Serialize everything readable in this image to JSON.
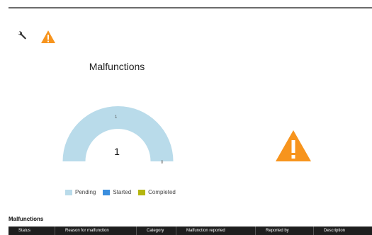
{
  "icons": {
    "tool": "wrench-icon",
    "alert": "warning-icon",
    "alert_color": "#f7941d"
  },
  "chart_data": {
    "type": "gauge",
    "title": "Malfunctions",
    "center_value": "1",
    "value_labels": [
      "1",
      "0"
    ],
    "series": [
      {
        "name": "Pending",
        "value": 1,
        "color": "#b9dbea"
      },
      {
        "name": "Started",
        "value": 0,
        "color": "#3b8ede"
      },
      {
        "name": "Completed",
        "value": 0,
        "color": "#b5b60f"
      }
    ]
  },
  "section": {
    "title": "Malfunctions"
  },
  "table": {
    "columns": [
      "Status",
      "Reason for malfunction",
      "Category",
      "Malfunction reported",
      "Reported by",
      "Description"
    ]
  }
}
